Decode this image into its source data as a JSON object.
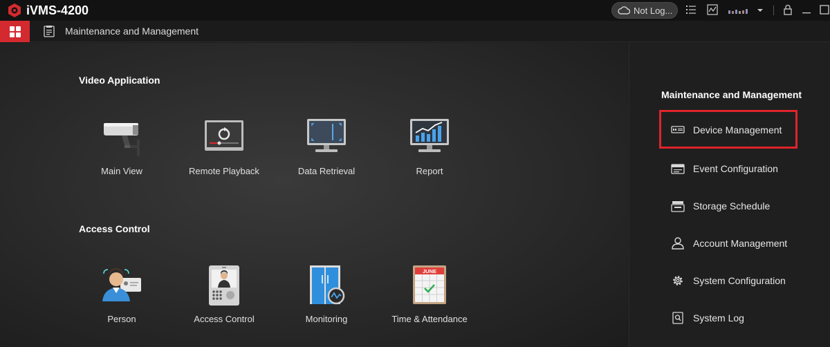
{
  "app": {
    "title": "iVMS-4200",
    "login_status": "Not Log...",
    "accent": "#d32a2f"
  },
  "nav": {
    "page_title": "Maintenance and Management"
  },
  "sections": [
    {
      "title": "Video Application",
      "tiles": [
        {
          "label": "Main View",
          "icon": "camera-icon"
        },
        {
          "label": "Remote Playback",
          "icon": "playback-icon"
        },
        {
          "label": "Data Retrieval",
          "icon": "monitor-icon"
        },
        {
          "label": "Report",
          "icon": "report-chart-icon"
        }
      ]
    },
    {
      "title": "Access Control",
      "tiles": [
        {
          "label": "Person",
          "icon": "person-card-icon"
        },
        {
          "label": "Access Control",
          "icon": "door-station-icon"
        },
        {
          "label": "Monitoring",
          "icon": "door-monitor-icon"
        },
        {
          "label": "Time & Attendance",
          "icon": "calendar-icon",
          "calendar_month": "JUNE"
        }
      ]
    }
  ],
  "right_panel": {
    "title": "Maintenance and Management",
    "items": [
      {
        "label": "Device Management",
        "icon": "device-icon",
        "selected": true
      },
      {
        "label": "Event Configuration",
        "icon": "event-icon"
      },
      {
        "label": "Storage Schedule",
        "icon": "storage-icon"
      },
      {
        "label": "Account Management",
        "icon": "account-icon"
      },
      {
        "label": "System Configuration",
        "icon": "gear-icon"
      },
      {
        "label": "System Log",
        "icon": "log-icon"
      }
    ]
  }
}
